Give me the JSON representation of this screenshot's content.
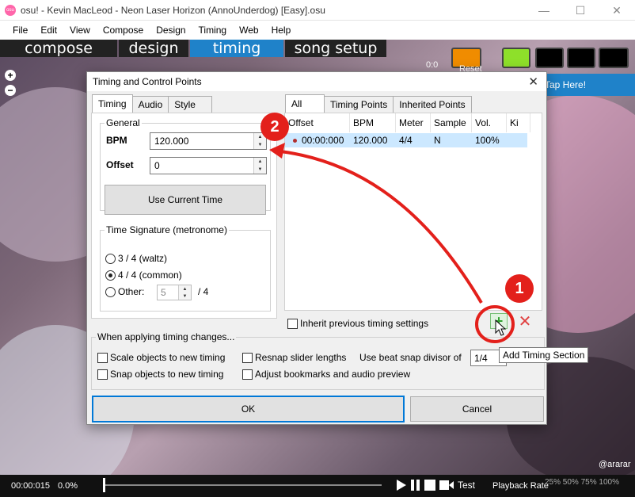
{
  "window": {
    "title": "osu! - Kevin MacLeod - Neon Laser Horizon (AnnoUnderdog) [Easy].osu",
    "minimize_glyph": "—",
    "maximize_glyph": "☐",
    "close_glyph": "✕"
  },
  "menubar": {
    "items": [
      "File",
      "Edit",
      "View",
      "Compose",
      "Design",
      "Timing",
      "Web",
      "Help"
    ]
  },
  "editor": {
    "tabs": [
      "compose",
      "design",
      "timing",
      "song setup"
    ],
    "active_tab": "timing",
    "zoom_in": "+",
    "zoom_out": "−",
    "time_counter": "0:0",
    "tap_here": "Tap Here!",
    "reset_label": "Reset",
    "swatch_colors": [
      "#f08c00",
      "#8ee02a",
      "#000000",
      "#000000",
      "#000000"
    ],
    "bottom_time": "00:00:015",
    "bottom_percent": "0.0%",
    "test_label": "Test",
    "playback_rate_label": "Playback Rate",
    "playback_options": "25% 50% 75% 100%",
    "watermark": "@ararar"
  },
  "dialog": {
    "title": "Timing and Control Points",
    "close_glyph": "✕",
    "left_tabs": [
      "Timing",
      "Audio",
      "Style"
    ],
    "general_legend": "General",
    "bpm_label": "BPM",
    "bpm_value": "120.000",
    "offset_label": "Offset",
    "offset_value": "0",
    "use_current_time": "Use Current Time",
    "time_signature_legend": "Time Signature (metronome)",
    "sig_options": [
      "3 / 4 (waltz)",
      "4 / 4 (common)",
      "Other:"
    ],
    "sig_selected": "4 / 4 (common)",
    "other_value": "5",
    "other_suffix": "/ 4",
    "right_tabs": [
      "All",
      "Timing Points",
      "Inherited Points"
    ],
    "table_headers": [
      "Offset",
      "BPM",
      "Meter",
      "Sample",
      "Vol.",
      "Ki"
    ],
    "table_rows": [
      {
        "offset": "00:00:000",
        "bpm": "120.000",
        "meter": "4/4",
        "sample": "N",
        "vol": "100%",
        "ki": ""
      }
    ],
    "inherit_label": "Inherit previous timing settings",
    "add_glyph": "+",
    "delete_glyph": "✕",
    "add_tooltip": "Add Timing Section",
    "changes_legend": "When applying timing changes...",
    "scale_objects": "Scale objects to new timing",
    "resnap_slider": "Resnap slider lengths",
    "beat_snap_label": "Use beat snap divisor of",
    "beat_snap_value": "1/4",
    "snap_objects": "Snap objects to new timing",
    "adjust_bookmarks": "Adjust bookmarks and audio preview",
    "ok": "OK",
    "cancel": "Cancel"
  },
  "annotations": {
    "badge_1": "1",
    "badge_2": "2",
    "highlight_color": "#e3201b"
  }
}
